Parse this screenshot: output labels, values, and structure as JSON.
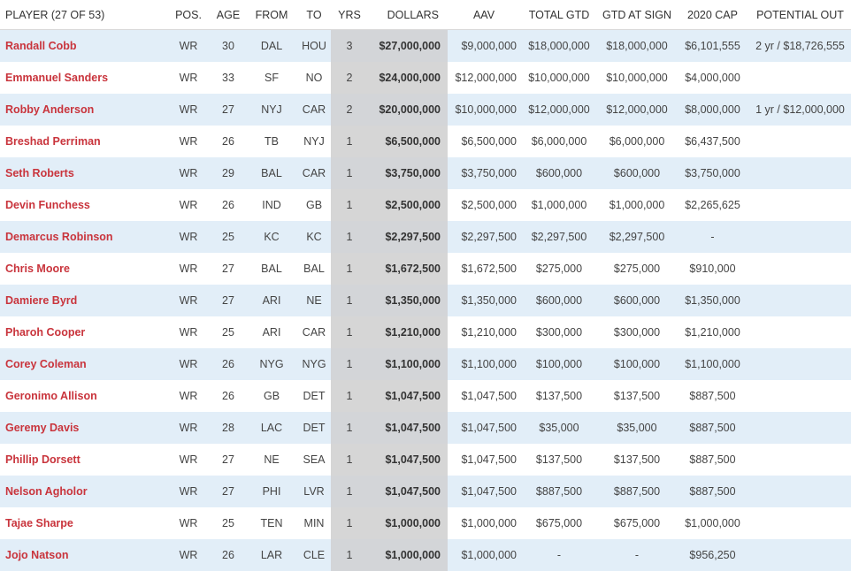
{
  "headers": {
    "player": "PLAYER (27 OF 53)",
    "pos": "POS.",
    "age": "AGE",
    "from": "FROM",
    "to": "TO",
    "yrs": "YRS",
    "dollars": "DOLLARS",
    "aav": "AAV",
    "total_gtd": "TOTAL GTD",
    "gtd_at_sign": "GTD AT SIGN",
    "cap_2020": "2020 CAP",
    "potential_out": "POTENTIAL OUT"
  },
  "colors": {
    "player_link": "#c9343c",
    "row_stripe": "#e2eef8",
    "highlight_column": "#d6d6d6"
  },
  "rows": [
    {
      "player": "Randall Cobb",
      "pos": "WR",
      "age": "30",
      "from": "DAL",
      "to": "HOU",
      "yrs": "3",
      "dollars": "$27,000,000",
      "aav": "$9,000,000",
      "total_gtd": "$18,000,000",
      "gtd_at_sign": "$18,000,000",
      "cap_2020": "$6,101,555",
      "potential_out": "2 yr / $18,726,555"
    },
    {
      "player": "Emmanuel Sanders",
      "pos": "WR",
      "age": "33",
      "from": "SF",
      "to": "NO",
      "yrs": "2",
      "dollars": "$24,000,000",
      "aav": "$12,000,000",
      "total_gtd": "$10,000,000",
      "gtd_at_sign": "$10,000,000",
      "cap_2020": "$4,000,000",
      "potential_out": ""
    },
    {
      "player": "Robby Anderson",
      "pos": "WR",
      "age": "27",
      "from": "NYJ",
      "to": "CAR",
      "yrs": "2",
      "dollars": "$20,000,000",
      "aav": "$10,000,000",
      "total_gtd": "$12,000,000",
      "gtd_at_sign": "$12,000,000",
      "cap_2020": "$8,000,000",
      "potential_out": "1 yr / $12,000,000"
    },
    {
      "player": "Breshad Perriman",
      "pos": "WR",
      "age": "26",
      "from": "TB",
      "to": "NYJ",
      "yrs": "1",
      "dollars": "$6,500,000",
      "aav": "$6,500,000",
      "total_gtd": "$6,000,000",
      "gtd_at_sign": "$6,000,000",
      "cap_2020": "$6,437,500",
      "potential_out": ""
    },
    {
      "player": "Seth Roberts",
      "pos": "WR",
      "age": "29",
      "from": "BAL",
      "to": "CAR",
      "yrs": "1",
      "dollars": "$3,750,000",
      "aav": "$3,750,000",
      "total_gtd": "$600,000",
      "gtd_at_sign": "$600,000",
      "cap_2020": "$3,750,000",
      "potential_out": ""
    },
    {
      "player": "Devin Funchess",
      "pos": "WR",
      "age": "26",
      "from": "IND",
      "to": "GB",
      "yrs": "1",
      "dollars": "$2,500,000",
      "aav": "$2,500,000",
      "total_gtd": "$1,000,000",
      "gtd_at_sign": "$1,000,000",
      "cap_2020": "$2,265,625",
      "potential_out": ""
    },
    {
      "player": "Demarcus Robinson",
      "pos": "WR",
      "age": "25",
      "from": "KC",
      "to": "KC",
      "yrs": "1",
      "dollars": "$2,297,500",
      "aav": "$2,297,500",
      "total_gtd": "$2,297,500",
      "gtd_at_sign": "$2,297,500",
      "cap_2020": "-",
      "potential_out": ""
    },
    {
      "player": "Chris Moore",
      "pos": "WR",
      "age": "27",
      "from": "BAL",
      "to": "BAL",
      "yrs": "1",
      "dollars": "$1,672,500",
      "aav": "$1,672,500",
      "total_gtd": "$275,000",
      "gtd_at_sign": "$275,000",
      "cap_2020": "$910,000",
      "potential_out": ""
    },
    {
      "player": "Damiere Byrd",
      "pos": "WR",
      "age": "27",
      "from": "ARI",
      "to": "NE",
      "yrs": "1",
      "dollars": "$1,350,000",
      "aav": "$1,350,000",
      "total_gtd": "$600,000",
      "gtd_at_sign": "$600,000",
      "cap_2020": "$1,350,000",
      "potential_out": ""
    },
    {
      "player": "Pharoh Cooper",
      "pos": "WR",
      "age": "25",
      "from": "ARI",
      "to": "CAR",
      "yrs": "1",
      "dollars": "$1,210,000",
      "aav": "$1,210,000",
      "total_gtd": "$300,000",
      "gtd_at_sign": "$300,000",
      "cap_2020": "$1,210,000",
      "potential_out": ""
    },
    {
      "player": "Corey Coleman",
      "pos": "WR",
      "age": "26",
      "from": "NYG",
      "to": "NYG",
      "yrs": "1",
      "dollars": "$1,100,000",
      "aav": "$1,100,000",
      "total_gtd": "$100,000",
      "gtd_at_sign": "$100,000",
      "cap_2020": "$1,100,000",
      "potential_out": ""
    },
    {
      "player": "Geronimo Allison",
      "pos": "WR",
      "age": "26",
      "from": "GB",
      "to": "DET",
      "yrs": "1",
      "dollars": "$1,047,500",
      "aav": "$1,047,500",
      "total_gtd": "$137,500",
      "gtd_at_sign": "$137,500",
      "cap_2020": "$887,500",
      "potential_out": ""
    },
    {
      "player": "Geremy Davis",
      "pos": "WR",
      "age": "28",
      "from": "LAC",
      "to": "DET",
      "yrs": "1",
      "dollars": "$1,047,500",
      "aav": "$1,047,500",
      "total_gtd": "$35,000",
      "gtd_at_sign": "$35,000",
      "cap_2020": "$887,500",
      "potential_out": ""
    },
    {
      "player": "Phillip Dorsett",
      "pos": "WR",
      "age": "27",
      "from": "NE",
      "to": "SEA",
      "yrs": "1",
      "dollars": "$1,047,500",
      "aav": "$1,047,500",
      "total_gtd": "$137,500",
      "gtd_at_sign": "$137,500",
      "cap_2020": "$887,500",
      "potential_out": ""
    },
    {
      "player": "Nelson Agholor",
      "pos": "WR",
      "age": "27",
      "from": "PHI",
      "to": "LVR",
      "yrs": "1",
      "dollars": "$1,047,500",
      "aav": "$1,047,500",
      "total_gtd": "$887,500",
      "gtd_at_sign": "$887,500",
      "cap_2020": "$887,500",
      "potential_out": ""
    },
    {
      "player": "Tajae Sharpe",
      "pos": "WR",
      "age": "25",
      "from": "TEN",
      "to": "MIN",
      "yrs": "1",
      "dollars": "$1,000,000",
      "aav": "$1,000,000",
      "total_gtd": "$675,000",
      "gtd_at_sign": "$675,000",
      "cap_2020": "$1,000,000",
      "potential_out": ""
    },
    {
      "player": "Jojo Natson",
      "pos": "WR",
      "age": "26",
      "from": "LAR",
      "to": "CLE",
      "yrs": "1",
      "dollars": "$1,000,000",
      "aav": "$1,000,000",
      "total_gtd": "-",
      "gtd_at_sign": "-",
      "cap_2020": "$956,250",
      "potential_out": ""
    }
  ]
}
